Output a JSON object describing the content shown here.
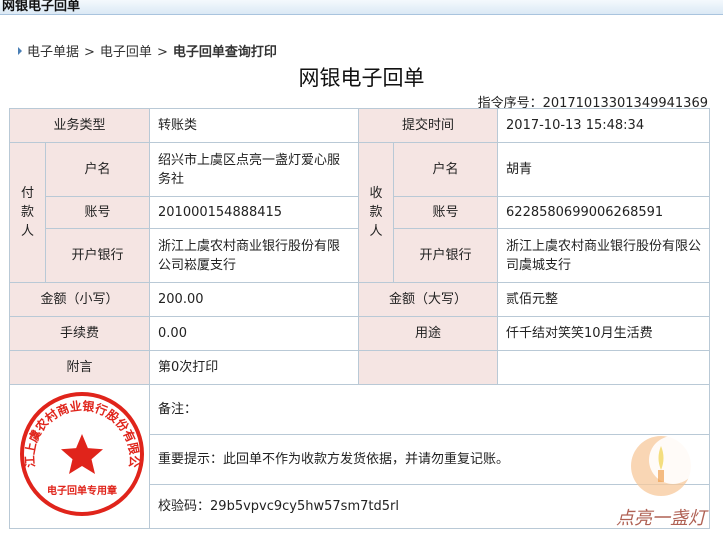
{
  "window": {
    "title": "网银电子回单"
  },
  "breadcrumb": {
    "items": [
      "电子单据",
      "电子回单"
    ],
    "current": "电子回单查询打印",
    "separator": ">"
  },
  "document": {
    "title": "网银电子回单",
    "serial_label": "指令序号：",
    "serial_value": "20171013301349941369"
  },
  "receipt": {
    "business_type_label": "业务类型",
    "business_type_value": "转账类",
    "submit_time_label": "提交时间",
    "submit_time_value": "2017-10-13 15:48:34",
    "payer_label": "付款人",
    "payee_label": "收款人",
    "payer": {
      "name_label": "户名",
      "name": "绍兴市上虞区点亮一盏灯爱心服务社",
      "account_label": "账号",
      "account": "201000154888415",
      "bank_label": "开户银行",
      "bank": "浙江上虞农村商业银行股份有限公司崧厦支行"
    },
    "payee": {
      "name_label": "户名",
      "name": "胡青",
      "account_label": "账号",
      "account": "6228580699006268591",
      "bank_label": "开户银行",
      "bank": "浙江上虞农村商业银行股份有限公司虞城支行"
    },
    "amount_small_label": "金额（小写）",
    "amount_small": "200.00",
    "amount_big_label": "金额（大写）",
    "amount_big": "贰佰元整",
    "fee_label": "手续费",
    "fee": "0.00",
    "purpose_label": "用途",
    "purpose": "仟千结对笑笑10月生活费",
    "postscript_label": "附言",
    "postscript": "第0次打印",
    "remark_label": "备注：",
    "notice": "重要提示：此回单不作为收款方发货依据，并请勿重复记账。",
    "verify_label": "校验码：",
    "verify_code": "29b5vpvc9cy5hw57sm7td5rl"
  },
  "seal": {
    "ring_text": "浙江上虞农村商业银行股份有限公司",
    "bottom_text": "电子回单专用章",
    "color": "#e0241b"
  },
  "watermark": {
    "text": "点亮一盏灯",
    "color": "#f0a050"
  }
}
